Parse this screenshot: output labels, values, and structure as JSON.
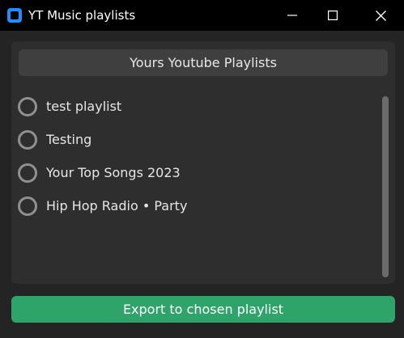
{
  "window": {
    "title": "YT Music playlists",
    "icons": {
      "app": "app-icon",
      "minimize": "minimize-icon",
      "maximize": "maximize-icon",
      "close": "close-icon"
    }
  },
  "panel": {
    "header": "Yours Youtube Playlists",
    "items": [
      {
        "label": "test playlist",
        "selected": false
      },
      {
        "label": "Testing",
        "selected": false
      },
      {
        "label": "Your Top Songs 2023",
        "selected": false
      },
      {
        "label": "Hip Hop Radio • Party",
        "selected": false
      }
    ]
  },
  "actions": {
    "export_label": "Export to chosen playlist"
  },
  "colors": {
    "titlebar": "#000000",
    "window_bg": "#242424",
    "panel_bg": "#2e2e2e",
    "header_bg": "#3f3f3f",
    "accent": "#2ea36a",
    "app_icon": "#1f8fff"
  }
}
